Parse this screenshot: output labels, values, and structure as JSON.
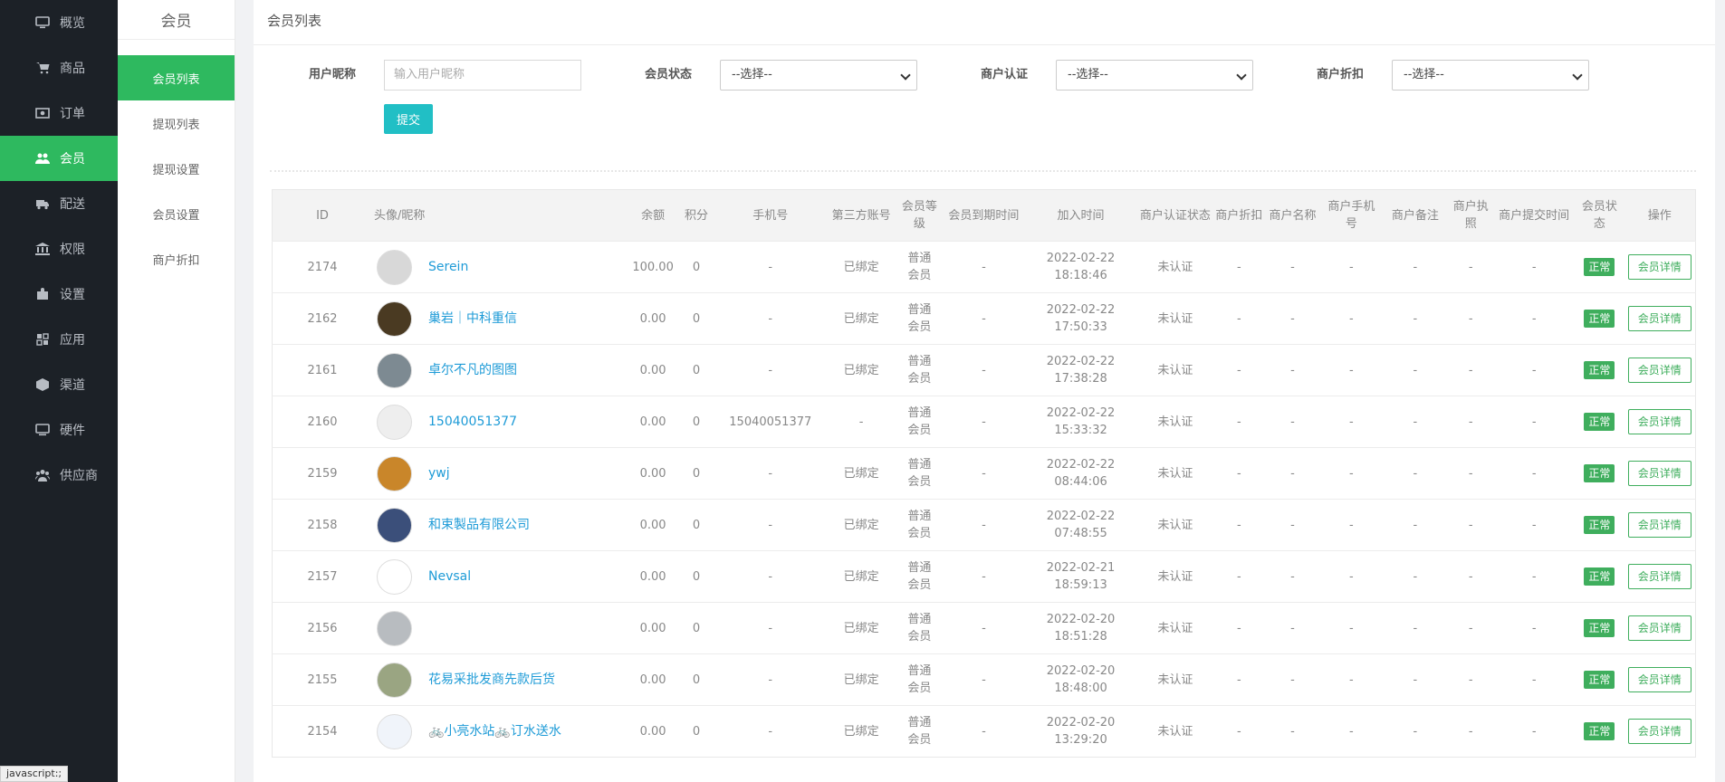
{
  "nav": {
    "items": [
      {
        "label": "概览",
        "icon": "monitor-icon"
      },
      {
        "label": "商品",
        "icon": "cart-icon"
      },
      {
        "label": "订单",
        "icon": "money-icon"
      },
      {
        "label": "会员",
        "icon": "users-icon"
      },
      {
        "label": "配送",
        "icon": "truck-icon"
      },
      {
        "label": "权限",
        "icon": "bank-icon"
      },
      {
        "label": "设置",
        "icon": "puzzle-icon"
      },
      {
        "label": "应用",
        "icon": "apps-icon"
      },
      {
        "label": "渠道",
        "icon": "cube-icon"
      },
      {
        "label": "硬件",
        "icon": "desktop-icon"
      },
      {
        "label": "供应商",
        "icon": "group-icon"
      }
    ],
    "active_index": 3
  },
  "subnav": {
    "heading": "会员",
    "items": [
      "会员列表",
      "提现列表",
      "提现设置",
      "会员设置",
      "商户折扣"
    ]
  },
  "page": {
    "title": "会员列表"
  },
  "filters": {
    "nickname_label": "用户昵称",
    "nickname_placeholder": "输入用户昵称",
    "status_label": "会员状态",
    "status_value": "--选择--",
    "merchant_auth_label": "商户认证",
    "merchant_auth_value": "--选择--",
    "merchant_discount_label": "商户折扣",
    "merchant_discount_value": "--选择--",
    "submit_label": "提交"
  },
  "table": {
    "headers": [
      "ID",
      "头像/昵称",
      "余额",
      "积分",
      "手机号",
      "第三方账号",
      "会员等级",
      "会员到期时间",
      "加入时间",
      "商户认证状态",
      "商户折扣",
      "商户名称",
      "商户手机号",
      "商户备注",
      "商户执照",
      "商户提交时间",
      "会员状态",
      "操作"
    ],
    "rows": [
      {
        "id": "2174",
        "nick": "Serein",
        "balance": "100.00",
        "points": "0",
        "phone": "-",
        "third": "已绑定",
        "level": "普通会员",
        "expire": "-",
        "join_date": "2022-02-22",
        "join_time": "18:18:46",
        "auth": "未认证",
        "discount": "-",
        "mname": "-",
        "mphone": "-",
        "mnote": "-",
        "mlicense": "-",
        "msubmit": "-",
        "status": "正常",
        "action": "会员详情",
        "avatar_color": "#d8d8d8"
      },
      {
        "id": "2162",
        "nick": "巢岩｜中科重信",
        "balance": "0.00",
        "points": "0",
        "phone": "-",
        "third": "已绑定",
        "level": "普通会员",
        "expire": "-",
        "join_date": "2022-02-22",
        "join_time": "17:50:33",
        "auth": "未认证",
        "discount": "-",
        "mname": "-",
        "mphone": "-",
        "mnote": "-",
        "mlicense": "-",
        "msubmit": "-",
        "status": "正常",
        "action": "会员详情",
        "avatar_color": "#4a3a22"
      },
      {
        "id": "2161",
        "nick": "卓尔不凡的图图",
        "balance": "0.00",
        "points": "0",
        "phone": "-",
        "third": "已绑定",
        "level": "普通会员",
        "expire": "-",
        "join_date": "2022-02-22",
        "join_time": "17:38:28",
        "auth": "未认证",
        "discount": "-",
        "mname": "-",
        "mphone": "-",
        "mnote": "-",
        "mlicense": "-",
        "msubmit": "-",
        "status": "正常",
        "action": "会员详情",
        "avatar_color": "#7d8a92"
      },
      {
        "id": "2160",
        "nick": "15040051377",
        "balance": "0.00",
        "points": "0",
        "phone": "15040051377",
        "third": "-",
        "level": "普通会员",
        "expire": "-",
        "join_date": "2022-02-22",
        "join_time": "15:33:32",
        "auth": "未认证",
        "discount": "-",
        "mname": "-",
        "mphone": "-",
        "mnote": "-",
        "mlicense": "-",
        "msubmit": "-",
        "status": "正常",
        "action": "会员详情",
        "avatar_color": "#eeeeee"
      },
      {
        "id": "2159",
        "nick": "ywj",
        "balance": "0.00",
        "points": "0",
        "phone": "-",
        "third": "已绑定",
        "level": "普通会员",
        "expire": "-",
        "join_date": "2022-02-22",
        "join_time": "08:44:06",
        "auth": "未认证",
        "discount": "-",
        "mname": "-",
        "mphone": "-",
        "mnote": "-",
        "mlicense": "-",
        "msubmit": "-",
        "status": "正常",
        "action": "会员详情",
        "avatar_color": "#c9862a"
      },
      {
        "id": "2158",
        "nick": "和束製品有限公司",
        "balance": "0.00",
        "points": "0",
        "phone": "-",
        "third": "已绑定",
        "level": "普通会员",
        "expire": "-",
        "join_date": "2022-02-22",
        "join_time": "07:48:55",
        "auth": "未认证",
        "discount": "-",
        "mname": "-",
        "mphone": "-",
        "mnote": "-",
        "mlicense": "-",
        "msubmit": "-",
        "status": "正常",
        "action": "会员详情",
        "avatar_color": "#3b4f7a"
      },
      {
        "id": "2157",
        "nick": "Nevsal",
        "balance": "0.00",
        "points": "0",
        "phone": "-",
        "third": "已绑定",
        "level": "普通会员",
        "expire": "-",
        "join_date": "2022-02-21",
        "join_time": "18:59:13",
        "auth": "未认证",
        "discount": "-",
        "mname": "-",
        "mphone": "-",
        "mnote": "-",
        "mlicense": "-",
        "msubmit": "-",
        "status": "正常",
        "action": "会员详情",
        "avatar_color": "#ffffff"
      },
      {
        "id": "2156",
        "nick": "",
        "balance": "0.00",
        "points": "0",
        "phone": "-",
        "third": "已绑定",
        "level": "普通会员",
        "expire": "-",
        "join_date": "2022-02-20",
        "join_time": "18:51:28",
        "auth": "未认证",
        "discount": "-",
        "mname": "-",
        "mphone": "-",
        "mnote": "-",
        "mlicense": "-",
        "msubmit": "-",
        "status": "正常",
        "action": "会员详情",
        "avatar_color": "#b8bcc0"
      },
      {
        "id": "2155",
        "nick": "花易采批发商先款后货",
        "balance": "0.00",
        "points": "0",
        "phone": "-",
        "third": "已绑定",
        "level": "普通会员",
        "expire": "-",
        "join_date": "2022-02-20",
        "join_time": "18:48:00",
        "auth": "未认证",
        "discount": "-",
        "mname": "-",
        "mphone": "-",
        "mnote": "-",
        "mlicense": "-",
        "msubmit": "-",
        "status": "正常",
        "action": "会员详情",
        "avatar_color": "#9aa582"
      },
      {
        "id": "2154",
        "nick": "🚲小亮水站🚲订水送水",
        "balance": "0.00",
        "points": "0",
        "phone": "-",
        "third": "已绑定",
        "level": "普通会员",
        "expire": "-",
        "join_date": "2022-02-20",
        "join_time": "13:29:20",
        "auth": "未认证",
        "discount": "-",
        "mname": "-",
        "mphone": "-",
        "mnote": "-",
        "mlicense": "-",
        "msubmit": "-",
        "status": "正常",
        "action": "会员详情",
        "avatar_color": "#f0f4fa"
      }
    ]
  },
  "statusbar": {
    "text": "javascript:;"
  },
  "colors": {
    "accent": "#2eb95f",
    "submit": "#21bfc5",
    "link": "#1e9bd7",
    "sidebar": "#1c2127"
  }
}
